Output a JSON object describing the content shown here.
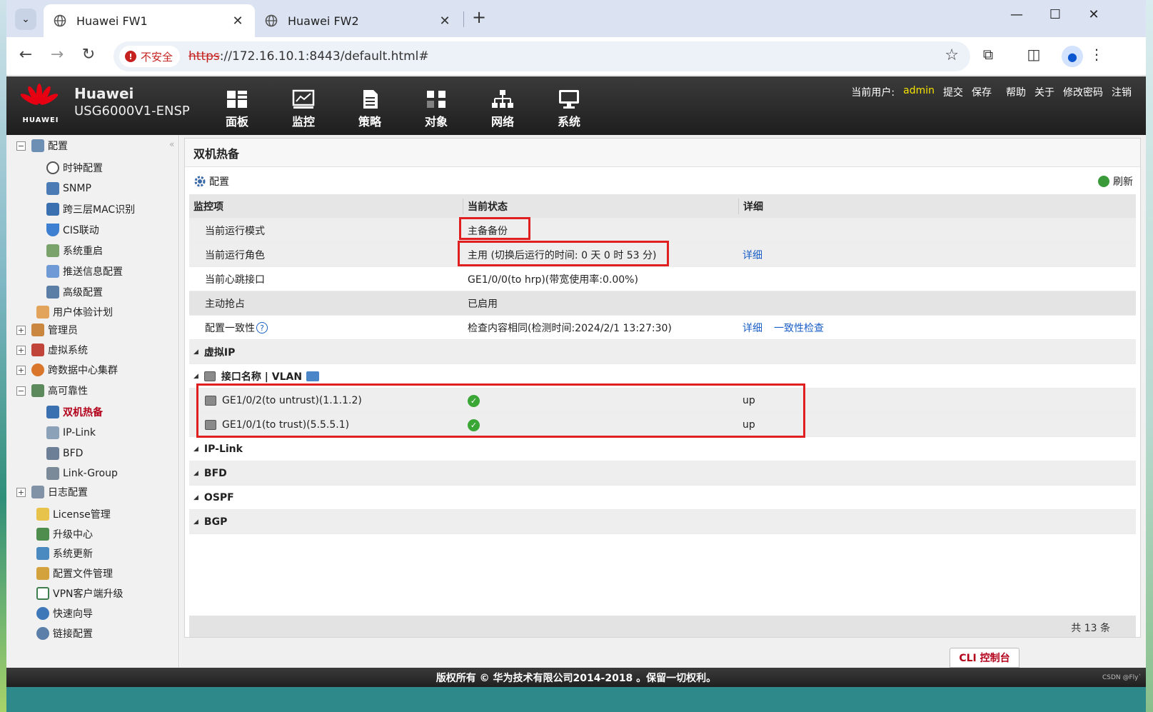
{
  "browser": {
    "tabs": [
      {
        "title": "Huawei FW1",
        "close": "✕"
      },
      {
        "title": "Huawei FW2",
        "close": "✕"
      }
    ],
    "new_tab": "+",
    "controls": {
      "minimize": "—",
      "maximize": "☐",
      "close": "✕"
    },
    "security_label": "不安全",
    "url_scheme": "https",
    "url_rest": "://172.16.10.1:8443/default.html#"
  },
  "header": {
    "brand": "HUAWEI",
    "product_line1": "Huawei",
    "product_line2": "USG6000V1-ENSP",
    "menu": [
      "面板",
      "监控",
      "策略",
      "对象",
      "网络",
      "系统"
    ],
    "user_label": "当前用户:",
    "user_name": "admin",
    "actions": [
      "提交",
      "保存",
      "帮助",
      "关于",
      "修改密码",
      "注销"
    ]
  },
  "sidebar": {
    "items": [
      {
        "label": "配置",
        "toggle": "−"
      },
      {
        "label": "时钟配置"
      },
      {
        "label": "SNMP"
      },
      {
        "label": "跨三层MAC识别"
      },
      {
        "label": "CIS联动"
      },
      {
        "label": "系统重启"
      },
      {
        "label": "推送信息配置"
      },
      {
        "label": "高级配置"
      },
      {
        "label": "用户体验计划"
      },
      {
        "label": "管理员",
        "toggle": "+"
      },
      {
        "label": "虚拟系统",
        "toggle": "+"
      },
      {
        "label": "跨数据中心集群",
        "toggle": "+"
      },
      {
        "label": "高可靠性",
        "toggle": "−"
      },
      {
        "label": "双机热备"
      },
      {
        "label": "IP-Link"
      },
      {
        "label": "BFD"
      },
      {
        "label": "Link-Group"
      },
      {
        "label": "日志配置",
        "toggle": "+"
      },
      {
        "label": "License管理"
      },
      {
        "label": "升级中心"
      },
      {
        "label": "系统更新"
      },
      {
        "label": "配置文件管理"
      },
      {
        "label": "VPN客户端升级"
      },
      {
        "label": "快速向导"
      },
      {
        "label": "链接配置"
      }
    ]
  },
  "panel": {
    "title": "双机热备",
    "config_label": "配置",
    "refresh_label": "刷新",
    "columns": [
      "监控项",
      "当前状态",
      "详细"
    ],
    "rows": [
      {
        "item": "当前运行模式",
        "status": "主备备份",
        "detail": ""
      },
      {
        "item": "当前运行角色",
        "status": "主用 (切换后运行的时间: 0 天 0 时 53 分)",
        "detail": "详细"
      },
      {
        "item": "当前心跳接口",
        "status": "GE1/0/0(to hrp)(带宽使用率:0.00%)",
        "detail": ""
      },
      {
        "item": "主动抢占",
        "status": "已启用",
        "detail": ""
      },
      {
        "item": "配置一致性",
        "status": "检查内容相同(检测时间:2024/2/1 13:27:30)",
        "detail": "详细",
        "detail2": "一致性检查"
      }
    ],
    "sections": [
      "虚拟IP",
      "接口名称 | VLAN",
      "IP-Link",
      "BFD",
      "OSPF",
      "BGP"
    ],
    "interfaces": [
      {
        "name": "GE1/0/2(to untrust)(1.1.1.2)",
        "state": "up"
      },
      {
        "name": "GE1/0/1(to trust)(5.5.5.1)",
        "state": "up"
      }
    ],
    "total": "共 13 条"
  },
  "cli_label": "CLI 控制台",
  "copyright": "版权所有 © 华为技术有限公司2014-2018 。保留一切权利。",
  "watermark": "CSDN @Fly`"
}
